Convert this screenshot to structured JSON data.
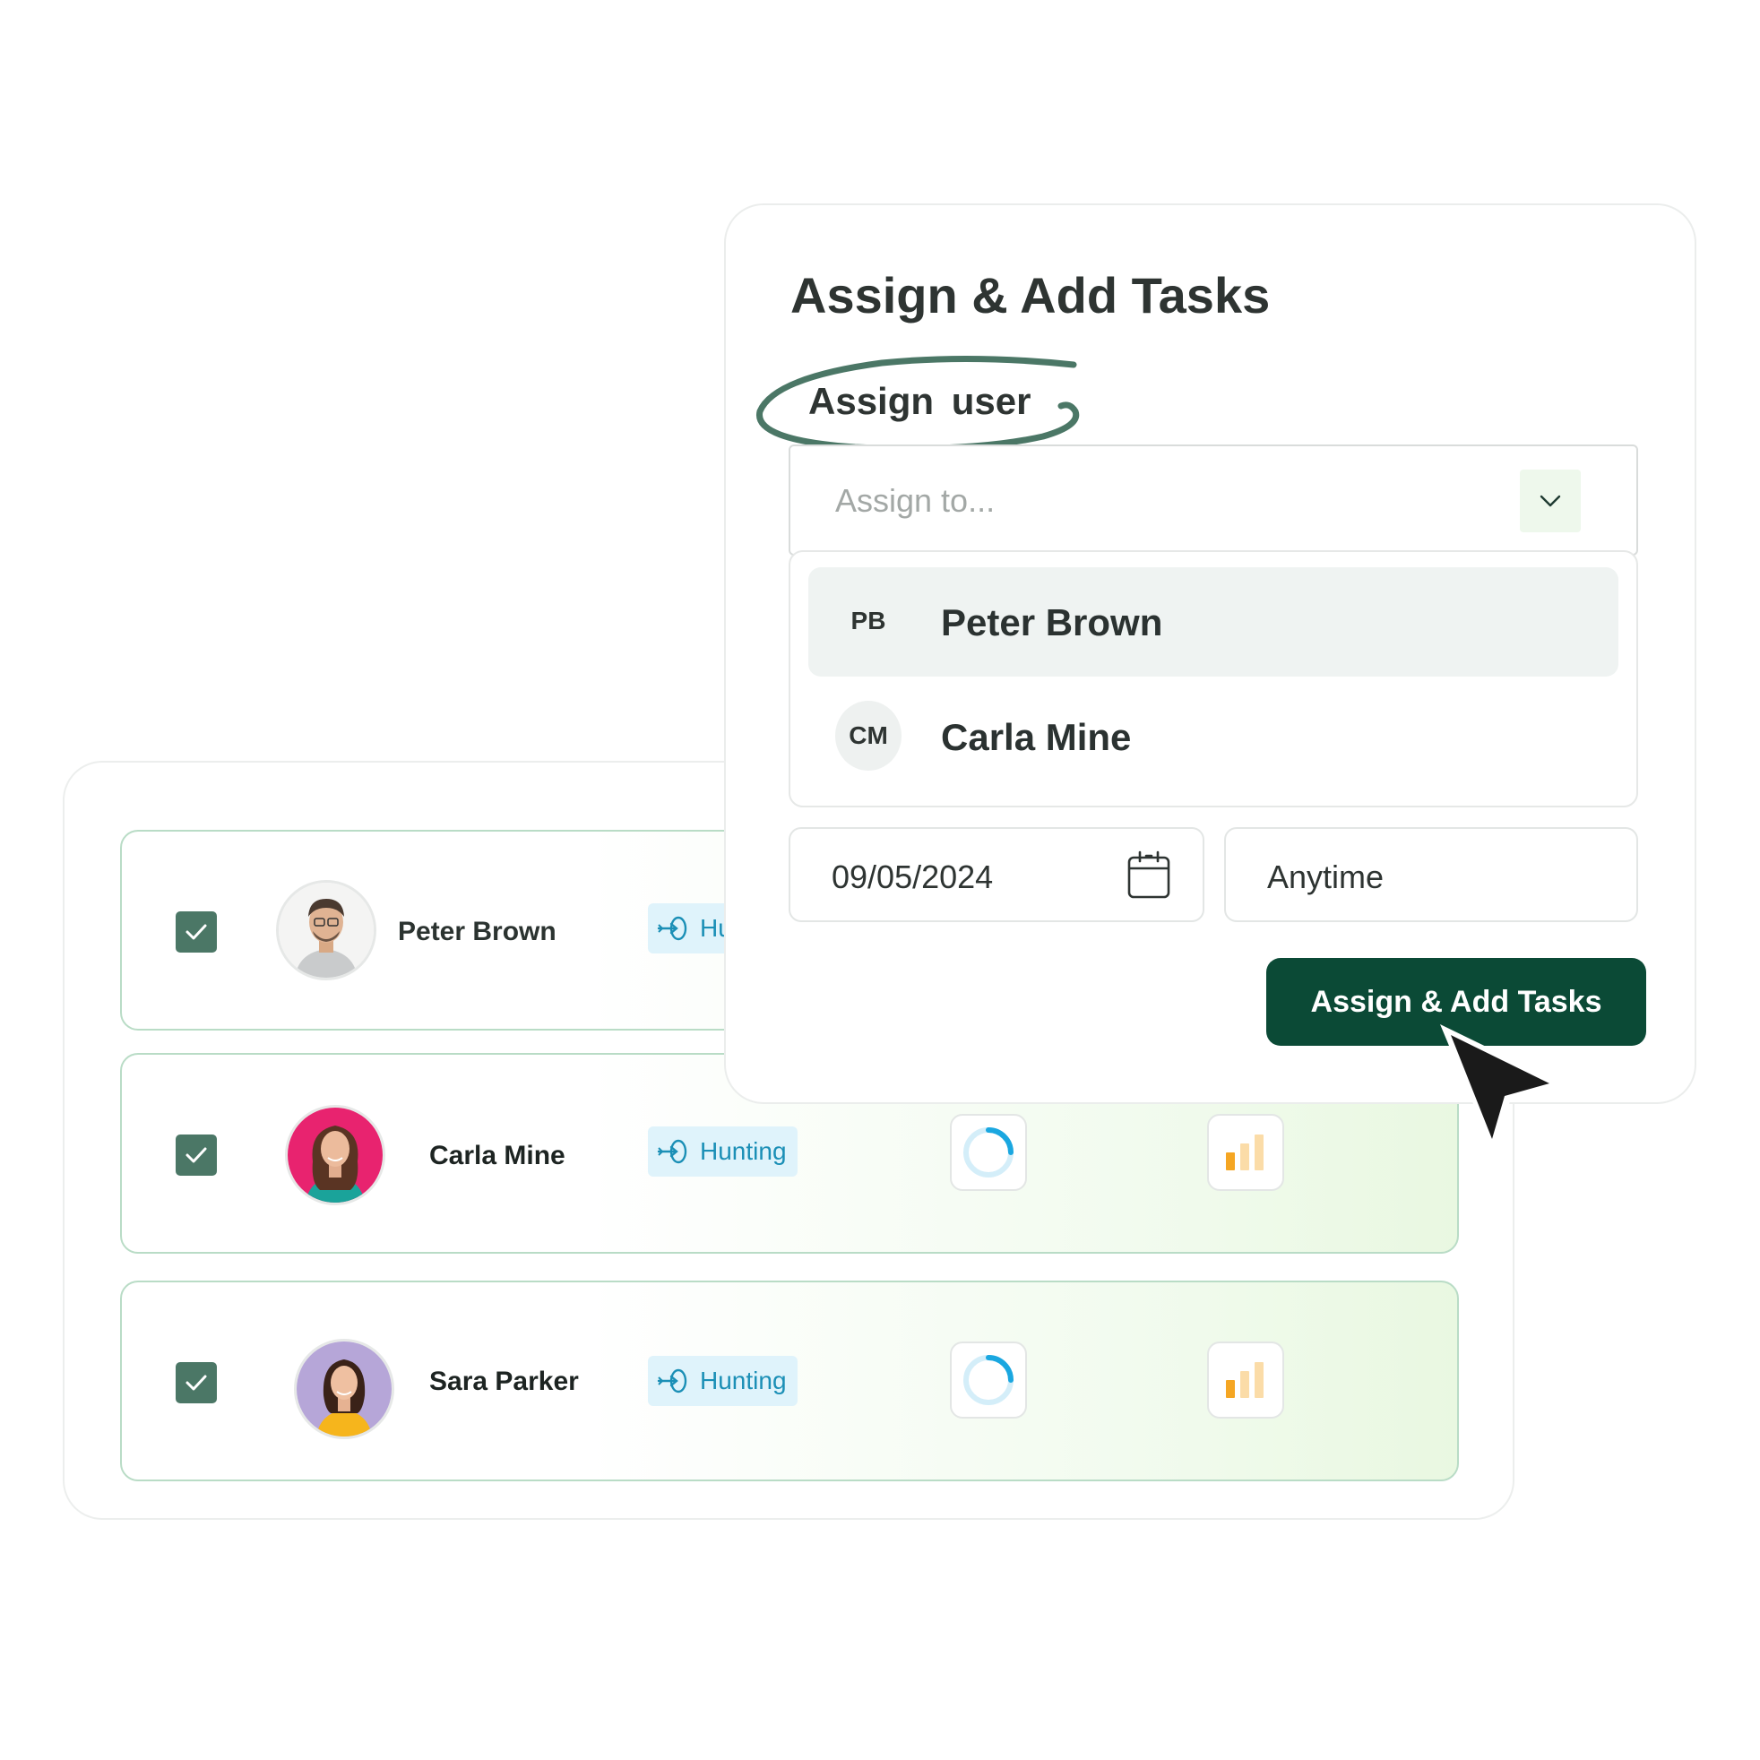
{
  "modal": {
    "title": "Assign & Add Tasks",
    "assign_label": "Assign  user",
    "select_placeholder": "Assign to...",
    "options": [
      {
        "initials": "PB",
        "name": "Peter Brown",
        "highlighted": true
      },
      {
        "initials": "CM",
        "name": "Carla Mine",
        "highlighted": false
      }
    ],
    "date_value": "09/05/2024",
    "time_value": "Anytime",
    "submit_label": "Assign & Add Tasks"
  },
  "rows": [
    {
      "name": "Peter Brown",
      "tag": "Hunting",
      "checked": true
    },
    {
      "name": "Carla Mine",
      "tag": "Hunting",
      "checked": true
    },
    {
      "name": "Sara Parker",
      "tag": "Hunting",
      "checked": true
    }
  ],
  "colors": {
    "primary": "#0b4a36",
    "checkbox": "#4b7766",
    "tag_bg": "#dff3fb",
    "tag_text": "#1b8fb6",
    "row_border": "#b9dcc6",
    "progress": "#1aa7e0",
    "bars": "#f5a623"
  },
  "icons": {
    "checkbox": "check-icon",
    "tag": "arrow-target-icon",
    "progress": "progress-ring-icon",
    "stats": "bar-chart-icon",
    "dropdown": "chevron-down-icon",
    "date": "calendar-icon",
    "pointer": "cursor-arrow-icon"
  }
}
